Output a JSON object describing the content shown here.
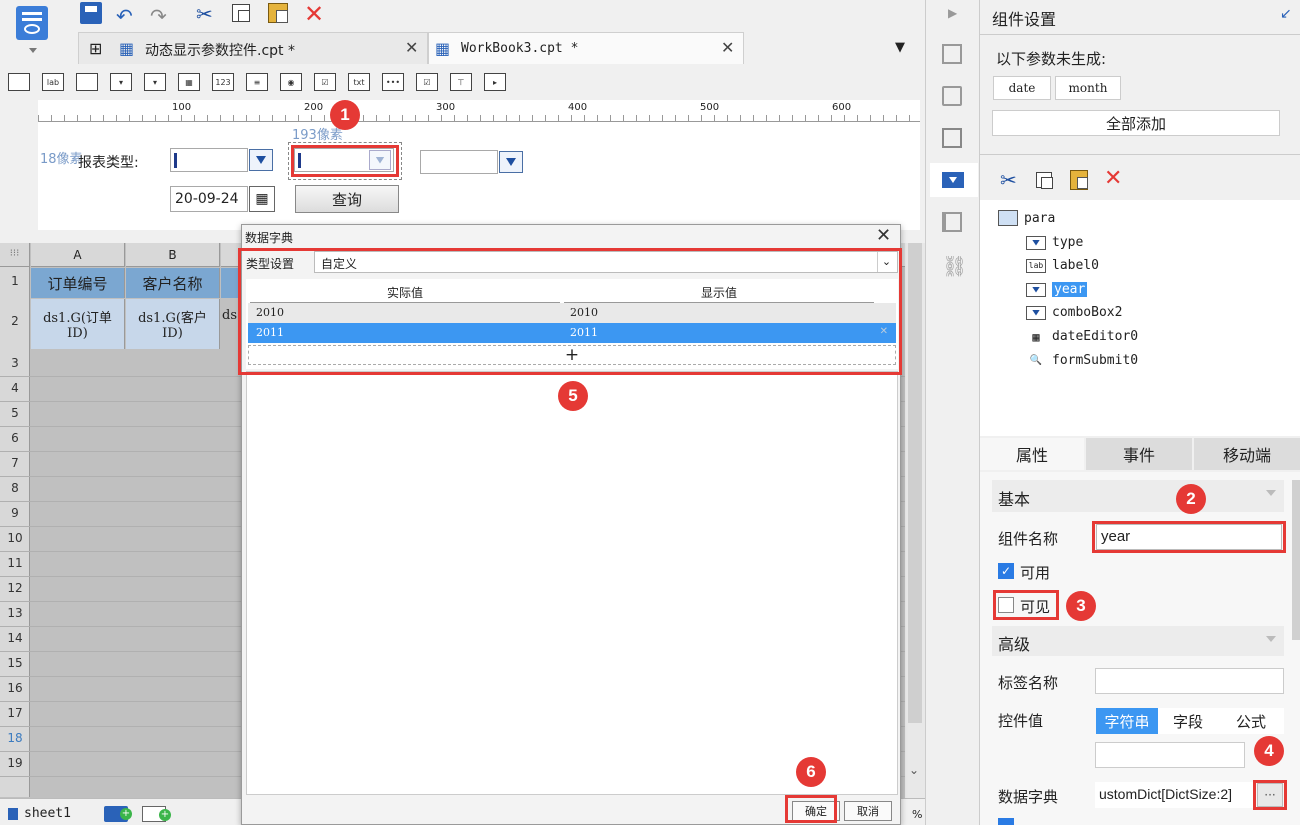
{
  "tabs": [
    {
      "label": "动态显示参数控件.cpt *"
    },
    {
      "label": "WorkBook3.cpt *"
    }
  ],
  "ruler": [
    "100",
    "200",
    "300",
    "400",
    "500",
    "600"
  ],
  "param_pane": {
    "label_pixel_left": "18像素",
    "label_pixel_top": "193像素",
    "report_type_label": "报表类型:",
    "date_value": "20-09-24",
    "query_button": "查询"
  },
  "sheet": {
    "col_headers": [
      "A",
      "B"
    ],
    "header_row1": [
      "订单编号",
      "客户名称"
    ],
    "header_row2": [
      "ds1.G(订单ID)",
      "ds1.G(客户ID)",
      "ds"
    ],
    "row_numbers": [
      "1",
      "2",
      "3",
      "4",
      "5",
      "6",
      "7",
      "8",
      "9",
      "10",
      "11",
      "12",
      "13",
      "14",
      "15",
      "16",
      "17",
      "18",
      "19"
    ],
    "sheet_tab": "sheet1"
  },
  "dialog": {
    "title": "数据字典",
    "type_label": "类型设置",
    "type_value": "自定义",
    "col_actual": "实际值",
    "col_display": "显示值",
    "rows": [
      {
        "actual": "2010",
        "display": "2010"
      },
      {
        "actual": "2011",
        "display": "2011"
      }
    ],
    "add_symbol": "+",
    "ok_button": "确定",
    "cancel_button": "取消"
  },
  "right_panel": {
    "title": "组件设置",
    "ungenerated_label": "以下参数未生成:",
    "params": [
      "date",
      "month"
    ],
    "add_all_button": "全部添加",
    "tree_root": "para",
    "tree_items": [
      "type",
      "label0",
      "year",
      "comboBox2",
      "dateEditor0",
      "formSubmit0"
    ],
    "selected_tree_item": "year",
    "prop_tabs": [
      "属性",
      "事件",
      "移动端"
    ],
    "section_basic": "基本",
    "name_label": "组件名称",
    "name_value": "year",
    "enabled_label": "可用",
    "visible_label": "可见",
    "section_advanced": "高级",
    "tag_name_label": "标签名称",
    "control_value_label": "控件值",
    "value_types": [
      "字符串",
      "字段",
      "公式"
    ],
    "dict_label": "数据字典",
    "dict_value": "ustomDict[DictSize:2]",
    "dict_more": "···"
  },
  "callouts": [
    "1",
    "2",
    "3",
    "4",
    "5",
    "6"
  ],
  "status": {
    "percent": "%"
  },
  "colors": {
    "accent": "#3c97f2",
    "callout": "#e53935",
    "grid_bg": "#c0c0c0",
    "header_bg": "#7ba7d1"
  }
}
